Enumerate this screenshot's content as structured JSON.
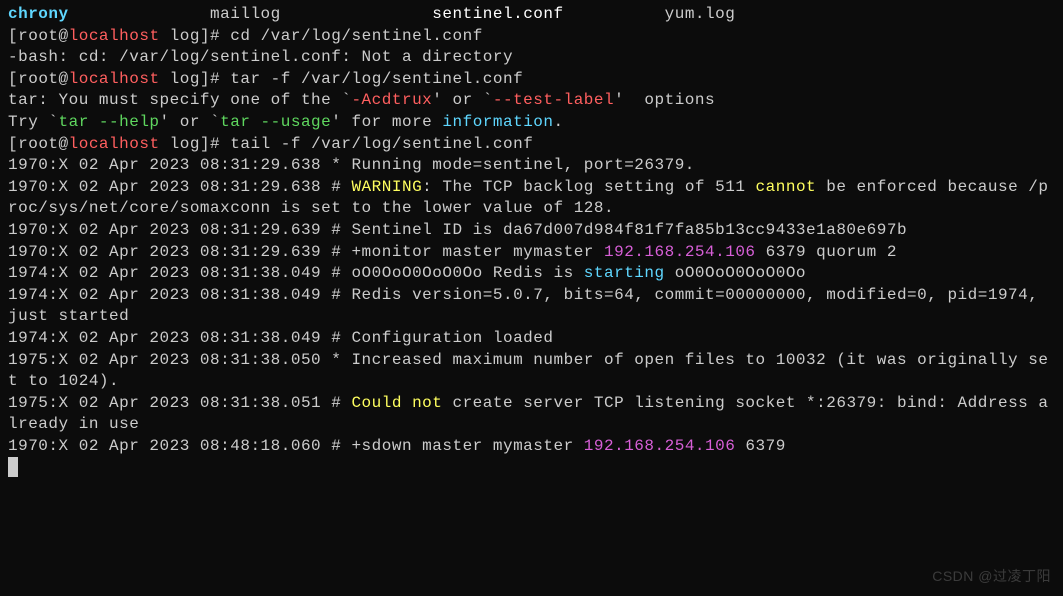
{
  "ls_row": {
    "col1": "chrony",
    "col2": "maillog",
    "col3": "sentinel.conf",
    "col4": "yum.log"
  },
  "prompt": {
    "open": "[",
    "user": "root@",
    "host": "localhost",
    "path": " log",
    "close": "]# "
  },
  "cmd1": "cd /var/log/sentinel.conf",
  "err1": "-bash: cd: /var/log/sentinel.conf: Not a directory",
  "cmd2": "tar -f /var/log/sentinel.conf",
  "tar_err": {
    "prefix": "tar: You must specify one of the `",
    "opt1": "-Acdtrux",
    "mid1": "' or `",
    "opt2": "--test-label",
    "suffix": "'  options"
  },
  "tar_try": {
    "prefix": "Try `",
    "help": "tar --help",
    "mid": "' or `",
    "usage": "tar --usage",
    "mid2": "' for more ",
    "info": "information",
    "suffix": "."
  },
  "cmd3": "tail -f /var/log/sentinel.conf",
  "log1": "1970:X 02 Apr 2023 08:31:29.638 * Running mode=sentinel, port=26379.",
  "log2": {
    "prefix": "1970:X 02 Apr 2023 08:31:29.638 # ",
    "warn": "WARNING",
    "mid": ": The TCP backlog setting of 511 ",
    "cannot": "cannot",
    "suffix": " be enforced because /proc/sys/net/core/somaxconn is set to the lower value of 128."
  },
  "log3": "1970:X 02 Apr 2023 08:31:29.639 # Sentinel ID is da67d007d984f81f7fa85b13cc9433e1a80e697b",
  "log4": {
    "prefix": "1970:X 02 Apr 2023 08:31:29.639 # +monitor master mymaster ",
    "ip": "192.168.254.106",
    "suffix": " 6379 quorum 2"
  },
  "log5": {
    "prefix": "1974:X 02 Apr 2023 08:31:38.049 # oO0OoO0OoO0Oo Redis is ",
    "starting": "starting",
    "suffix": " oO0OoO0OoO0Oo"
  },
  "log6": "1974:X 02 Apr 2023 08:31:38.049 # Redis version=5.0.7, bits=64, commit=00000000, modified=0, pid=1974, just started",
  "log7": "1974:X 02 Apr 2023 08:31:38.049 # Configuration loaded",
  "log8": "1975:X 02 Apr 2023 08:31:38.050 * Increased maximum number of open files to 10032 (it was originally set to 1024).",
  "log9": {
    "prefix": "1975:X 02 Apr 2023 08:31:38.051 # ",
    "err": "Could not",
    "suffix": " create server TCP listening socket *:26379: bind: Address already in use"
  },
  "log10": {
    "prefix": "1970:X 02 Apr 2023 08:48:18.060 # +sdown master mymaster ",
    "ip": "192.168.254.106",
    "suffix": " 6379"
  },
  "watermark": "CSDN @过凌丁阳"
}
